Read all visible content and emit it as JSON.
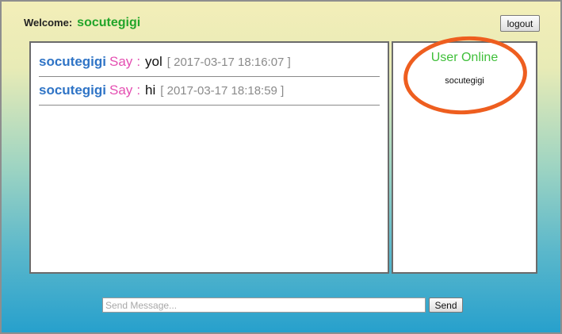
{
  "header": {
    "welcome_label": "Welcome:",
    "username": "socutegigi",
    "logout_label": "logout"
  },
  "chat": {
    "messages": [
      {
        "user": "socutegigi",
        "say": "Say",
        "colon": ":",
        "text": "yol",
        "time": "[ 2017-03-17 18:16:07 ]"
      },
      {
        "user": "socutegigi",
        "say": "Say",
        "colon": ":",
        "text": "hi",
        "time": "[ 2017-03-17 18:18:59 ]"
      }
    ]
  },
  "online": {
    "title": "User Online",
    "users": [
      "socutegigi"
    ]
  },
  "composer": {
    "placeholder": "Send Message...",
    "send_label": "Send"
  },
  "colors": {
    "username_green": "#22a52a",
    "message_user_blue": "#2f74c6",
    "say_pink": "#e44fb2",
    "online_title_green": "#3fbf3a",
    "annotation_circle_orange": "#ee5e1f"
  }
}
